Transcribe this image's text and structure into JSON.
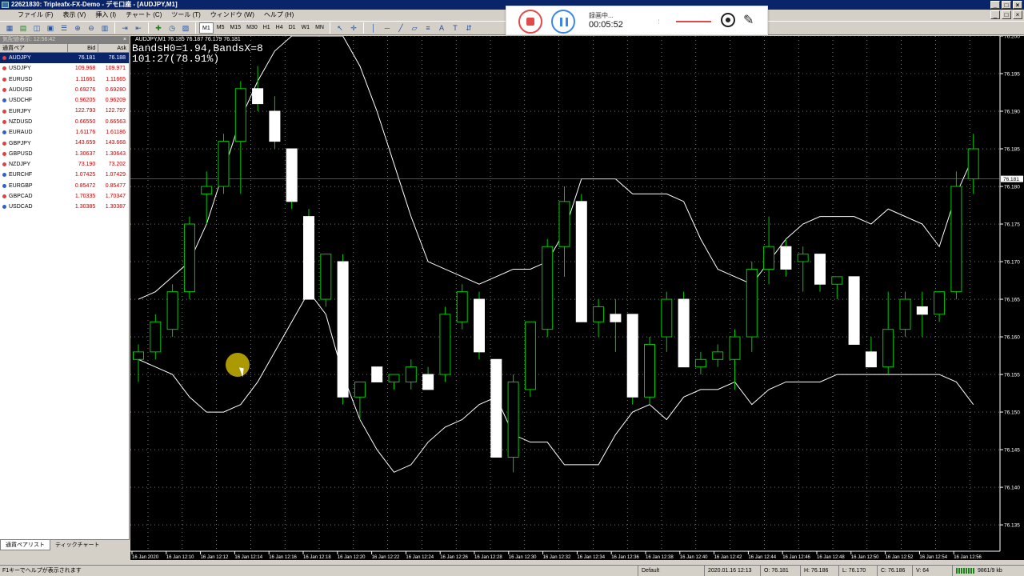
{
  "titlebar": {
    "title": "22621830: Tripleafx-FX-Demo - デモ口座 - [AUDJPY,M1]",
    "btn_min": "_",
    "btn_max": "□",
    "btn_close": "×"
  },
  "menu": {
    "items": [
      "ファイル (F)",
      "表示 (V)",
      "挿入 (I)",
      "チャート (C)",
      "ツール (T)",
      "ウィンドウ (W)",
      "ヘルプ (H)"
    ]
  },
  "toolbar": {
    "timeframes": [
      "M1",
      "M5",
      "M15",
      "M30",
      "H1",
      "H4",
      "D1",
      "W1",
      "MN"
    ],
    "active_timeframe": "M1"
  },
  "market_watch": {
    "header": "気配値表示: 12:56:42",
    "close": "×",
    "columns": {
      "symbol": "通貨ペア",
      "bid": "Bid",
      "ask": "Ask"
    },
    "rows": [
      {
        "symbol": "AUDJPY",
        "bid": "76.181",
        "ask": "76.188",
        "selected": true,
        "dir": "up"
      },
      {
        "symbol": "USDJPY",
        "bid": "109.968",
        "ask": "109.971",
        "dir": "up"
      },
      {
        "symbol": "EURUSD",
        "bid": "1.11661",
        "ask": "1.11665",
        "dir": "up"
      },
      {
        "symbol": "AUDUSD",
        "bid": "0.69276",
        "ask": "0.69280",
        "dir": "up"
      },
      {
        "symbol": "USDCHF",
        "bid": "0.96205",
        "ask": "0.96209",
        "dir": "down"
      },
      {
        "symbol": "EURJPY",
        "bid": "122.793",
        "ask": "122.797",
        "dir": "up"
      },
      {
        "symbol": "NZDUSD",
        "bid": "0.66550",
        "ask": "0.66563",
        "dir": "up"
      },
      {
        "symbol": "EURAUD",
        "bid": "1.61176",
        "ask": "1.61186",
        "dir": "down"
      },
      {
        "symbol": "GBPJPY",
        "bid": "143.659",
        "ask": "143.668",
        "dir": "up"
      },
      {
        "symbol": "GBPUSD",
        "bid": "1.30637",
        "ask": "1.30643",
        "dir": "up"
      },
      {
        "symbol": "NZDJPY",
        "bid": "73.190",
        "ask": "73.202",
        "dir": "up"
      },
      {
        "symbol": "EURCHF",
        "bid": "1.07425",
        "ask": "1.07429",
        "dir": "down"
      },
      {
        "symbol": "EURGBP",
        "bid": "0.85472",
        "ask": "0.85477",
        "dir": "down"
      },
      {
        "symbol": "GBPCAD",
        "bid": "1.70335",
        "ask": "1.70347",
        "dir": "up"
      },
      {
        "symbol": "USDCAD",
        "bid": "1.30385",
        "ask": "1.30387",
        "dir": "down"
      }
    ],
    "tabs": [
      "通貨ペアリスト",
      "ティックチャート"
    ]
  },
  "chart": {
    "header": "AUDJPY,M1  76.185 76.187 76.179 76.181",
    "indicator_line1": "BandsH0=1.94,BandsX=8",
    "indicator_line2": "101:27(78.91%)",
    "current_price_label": "76.181",
    "colors": {
      "bull": "#000000",
      "bear": "#ffffff",
      "wick": "#00c800",
      "bands": "#ffffff",
      "grid": "#c0c0c0"
    }
  },
  "chart_data": {
    "type": "candlestick",
    "symbol": "AUDJPY",
    "timeframe": "M1",
    "ylim": [
      76.1315,
      76.2
    ],
    "y_ticks": [
      76.2,
      76.195,
      76.19,
      76.185,
      76.18,
      76.175,
      76.17,
      76.165,
      76.16,
      76.155,
      76.15,
      76.145,
      76.14,
      76.135
    ],
    "y_tick_labels": [
      "76.200",
      "76.195",
      "76.190",
      "76.185",
      "76.180",
      "76.175",
      "76.170",
      "76.165",
      "76.160",
      "76.155",
      "76.150",
      "76.145",
      "76.140",
      "76.135"
    ],
    "x_labels": [
      "16 Jan 2020",
      "16 Jan 12:10",
      "16 Jan 12:12",
      "16 Jan 12:14",
      "16 Jan 12:16",
      "16 Jan 12:18",
      "16 Jan 12:20",
      "16 Jan 12:22",
      "16 Jan 12:24",
      "16 Jan 12:26",
      "16 Jan 12:28",
      "16 Jan 12:30",
      "16 Jan 12:32",
      "16 Jan 12:34",
      "16 Jan 12:36",
      "16 Jan 12:38",
      "16 Jan 12:40",
      "16 Jan 12:42",
      "16 Jan 12:44",
      "16 Jan 12:46",
      "16 Jan 12:48",
      "16 Jan 12:50",
      "16 Jan 12:52",
      "16 Jan 12:54",
      "16 Jan 12:56"
    ],
    "current_price": 76.181,
    "candles": [
      {
        "o": 76.157,
        "h": 76.159,
        "l": 76.154,
        "c": 76.158
      },
      {
        "o": 76.158,
        "h": 76.163,
        "l": 76.157,
        "c": 76.162
      },
      {
        "o": 76.161,
        "h": 76.167,
        "l": 76.16,
        "c": 76.166
      },
      {
        "o": 76.166,
        "h": 76.176,
        "l": 76.165,
        "c": 76.175
      },
      {
        "o": 76.179,
        "h": 76.182,
        "l": 76.175,
        "c": 76.18
      },
      {
        "o": 76.18,
        "h": 76.187,
        "l": 76.179,
        "c": 76.186
      },
      {
        "o": 76.186,
        "h": 76.194,
        "l": 76.179,
        "c": 76.193
      },
      {
        "o": 76.193,
        "h": 76.196,
        "l": 76.19,
        "c": 76.191
      },
      {
        "o": 76.19,
        "h": 76.192,
        "l": 76.185,
        "c": 76.186
      },
      {
        "o": 76.185,
        "h": 76.185,
        "l": 76.177,
        "c": 76.178
      },
      {
        "o": 76.176,
        "h": 76.177,
        "l": 76.165,
        "c": 76.165
      },
      {
        "o": 76.165,
        "h": 76.171,
        "l": 76.164,
        "c": 76.171
      },
      {
        "o": 76.17,
        "h": 76.171,
        "l": 76.151,
        "c": 76.152
      },
      {
        "o": 76.152,
        "h": 76.154,
        "l": 76.149,
        "c": 76.154
      },
      {
        "o": 76.156,
        "h": 76.156,
        "l": 76.154,
        "c": 76.154
      },
      {
        "o": 76.154,
        "h": 76.155,
        "l": 76.153,
        "c": 76.155
      },
      {
        "o": 76.154,
        "h": 76.157,
        "l": 76.153,
        "c": 76.156
      },
      {
        "o": 76.155,
        "h": 76.156,
        "l": 76.153,
        "c": 76.153
      },
      {
        "o": 76.155,
        "h": 76.164,
        "l": 76.154,
        "c": 76.163
      },
      {
        "o": 76.162,
        "h": 76.167,
        "l": 76.161,
        "c": 76.166
      },
      {
        "o": 76.165,
        "h": 76.166,
        "l": 76.157,
        "c": 76.158
      },
      {
        "o": 76.157,
        "h": 76.157,
        "l": 76.144,
        "c": 76.144
      },
      {
        "o": 76.144,
        "h": 76.155,
        "l": 76.142,
        "c": 76.154
      },
      {
        "o": 76.153,
        "h": 76.162,
        "l": 76.152,
        "c": 76.162
      },
      {
        "o": 76.161,
        "h": 76.173,
        "l": 76.16,
        "c": 76.172
      },
      {
        "o": 76.172,
        "h": 76.18,
        "l": 76.168,
        "c": 76.178
      },
      {
        "o": 76.178,
        "h": 76.179,
        "l": 76.162,
        "c": 76.162
      },
      {
        "o": 76.162,
        "h": 76.165,
        "l": 76.16,
        "c": 76.164
      },
      {
        "o": 76.163,
        "h": 76.165,
        "l": 76.158,
        "c": 76.162
      },
      {
        "o": 76.163,
        "h": 76.163,
        "l": 76.151,
        "c": 76.152
      },
      {
        "o": 76.152,
        "h": 76.16,
        "l": 76.151,
        "c": 76.159
      },
      {
        "o": 76.16,
        "h": 76.166,
        "l": 76.158,
        "c": 76.165
      },
      {
        "o": 76.165,
        "h": 76.166,
        "l": 76.156,
        "c": 76.156
      },
      {
        "o": 76.156,
        "h": 76.158,
        "l": 76.155,
        "c": 76.157
      },
      {
        "o": 76.157,
        "h": 76.159,
        "l": 76.156,
        "c": 76.158
      },
      {
        "o": 76.157,
        "h": 76.161,
        "l": 76.153,
        "c": 76.16
      },
      {
        "o": 76.16,
        "h": 76.17,
        "l": 76.158,
        "c": 76.169
      },
      {
        "o": 76.169,
        "h": 76.176,
        "l": 76.167,
        "c": 76.172
      },
      {
        "o": 76.172,
        "h": 76.173,
        "l": 76.168,
        "c": 76.169
      },
      {
        "o": 76.17,
        "h": 76.172,
        "l": 76.166,
        "c": 76.171
      },
      {
        "o": 76.171,
        "h": 76.171,
        "l": 76.166,
        "c": 76.167
      },
      {
        "o": 76.167,
        "h": 76.168,
        "l": 76.165,
        "c": 76.168
      },
      {
        "o": 76.168,
        "h": 76.168,
        "l": 76.159,
        "c": 76.159
      },
      {
        "o": 76.158,
        "h": 76.16,
        "l": 76.156,
        "c": 76.156
      },
      {
        "o": 76.156,
        "h": 76.166,
        "l": 76.155,
        "c": 76.161
      },
      {
        "o": 76.161,
        "h": 76.166,
        "l": 76.16,
        "c": 76.165
      },
      {
        "o": 76.164,
        "h": 76.166,
        "l": 76.16,
        "c": 76.163
      },
      {
        "o": 76.163,
        "h": 76.166,
        "l": 76.162,
        "c": 76.166
      },
      {
        "o": 76.166,
        "h": 76.182,
        "l": 76.165,
        "c": 76.18
      },
      {
        "o": 76.181,
        "h": 76.187,
        "l": 76.179,
        "c": 76.185
      }
    ],
    "bollinger_upper": [
      76.165,
      76.166,
      76.168,
      76.17,
      76.175,
      76.182,
      76.189,
      76.194,
      76.198,
      76.2,
      76.2,
      76.2,
      76.2,
      76.196,
      76.19,
      76.183,
      76.176,
      76.17,
      76.169,
      76.168,
      76.167,
      76.168,
      76.169,
      76.169,
      76.17,
      76.174,
      76.181,
      76.181,
      76.181,
      76.179,
      76.179,
      76.179,
      76.178,
      76.173,
      76.169,
      76.168,
      76.167,
      76.17,
      76.173,
      76.175,
      76.176,
      76.176,
      76.176,
      76.175,
      76.177,
      76.176,
      76.175,
      76.172,
      76.179,
      76.184
    ],
    "bollinger_lower": [
      76.157,
      76.156,
      76.155,
      76.152,
      76.15,
      76.15,
      76.151,
      76.154,
      76.158,
      76.162,
      76.166,
      76.163,
      76.155,
      76.149,
      76.145,
      76.142,
      76.143,
      76.146,
      76.148,
      76.149,
      76.151,
      76.152,
      76.147,
      76.146,
      76.146,
      76.143,
      76.143,
      76.143,
      76.147,
      76.15,
      76.151,
      76.149,
      76.152,
      76.153,
      76.153,
      76.154,
      76.151,
      76.153,
      76.154,
      76.154,
      76.154,
      76.155,
      76.155,
      76.155,
      76.155,
      76.155,
      76.155,
      76.155,
      76.154,
      76.151
    ]
  },
  "recorder": {
    "status": "録画中...",
    "time": "00:05:52"
  },
  "statusbar": {
    "help": "F1キーでヘルプが表示されます",
    "profile": "Default",
    "datetime": "2020.01.16 12:13",
    "open": "O: 76.181",
    "high": "H: 76.186",
    "low": "L: 76.170",
    "close": "C: 76.186",
    "volume": "V: 64",
    "traffic": "9861/9 kb"
  }
}
